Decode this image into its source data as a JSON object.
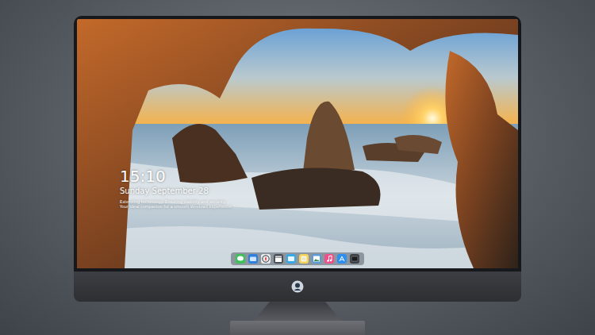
{
  "desktop": {
    "clock": {
      "time": "15:10",
      "date": "Sunday September 28",
      "lines": [
        "Extending technology. Ensuring stability and security.",
        "Your ideal companion for a smooth Windows experience."
      ]
    },
    "dock": {
      "items": [
        {
          "kind": "messages",
          "color": "#3ec15a"
        },
        {
          "kind": "files",
          "color": "#2f7fe0"
        },
        {
          "kind": "compass",
          "color": "#e9ecef"
        },
        {
          "kind": "clapper",
          "color": "#4a4f58"
        },
        {
          "kind": "video",
          "color": "#38a8e8"
        },
        {
          "kind": "notes",
          "color": "#f3d25a"
        },
        {
          "kind": "photos",
          "color": "#5a9bd8"
        },
        {
          "kind": "music",
          "color": "#f0508a"
        },
        {
          "kind": "store",
          "color": "#2d8ff0"
        },
        {
          "kind": "terminal",
          "color": "#3b3e44"
        }
      ]
    }
  }
}
